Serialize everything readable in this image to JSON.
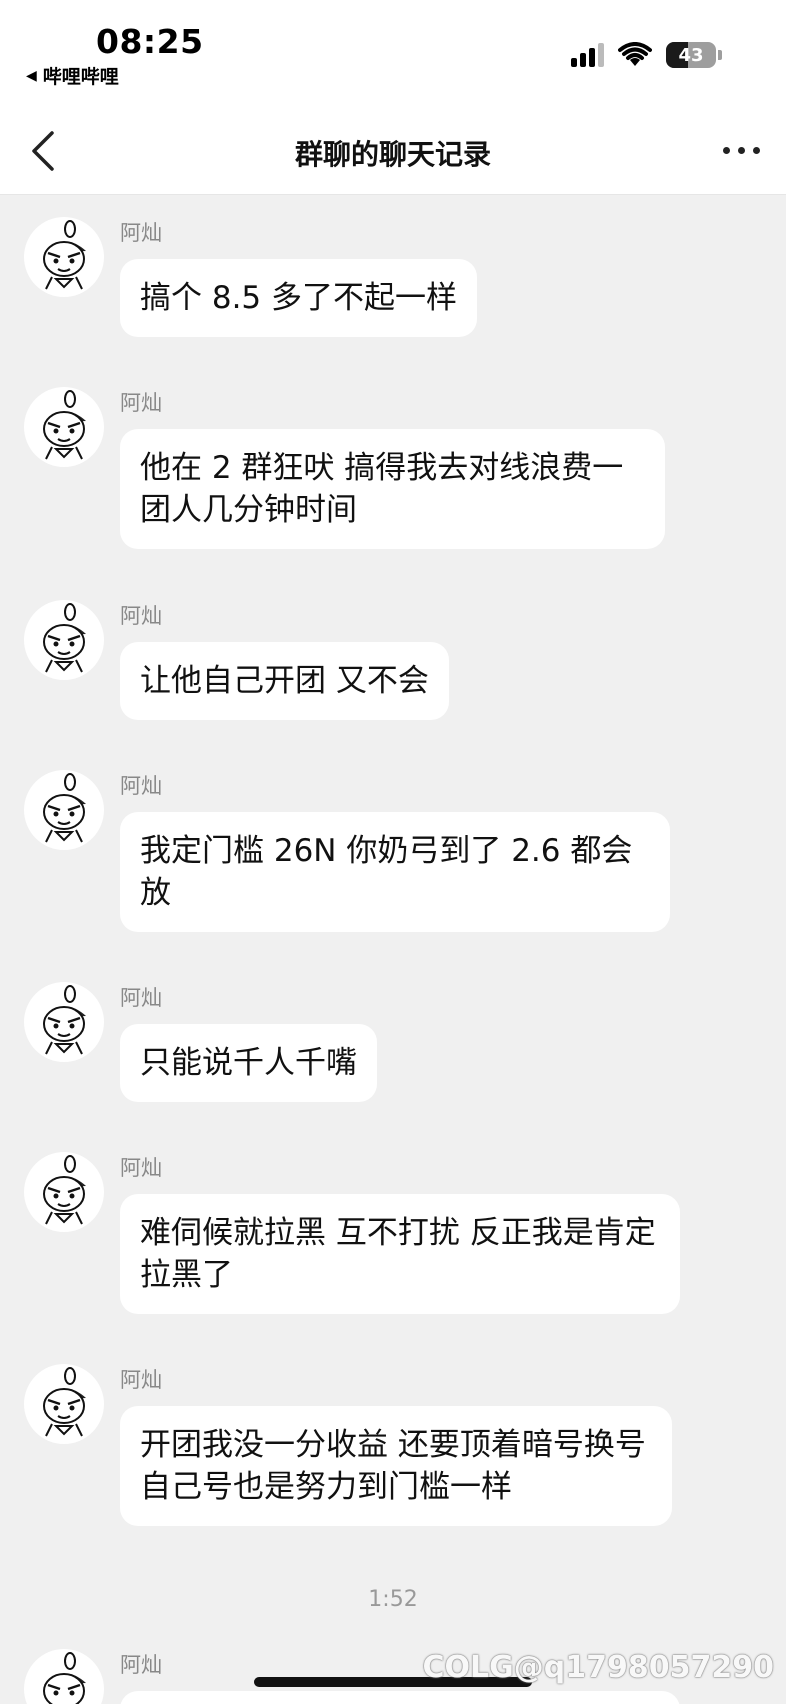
{
  "status_bar": {
    "time": "08:25",
    "back_app": "哔哩哔哩",
    "battery_level": "43",
    "battery_fraction": 0.43
  },
  "nav": {
    "title": "群聊的聊天记录"
  },
  "messages": [
    {
      "sender": "阿灿",
      "text": "搞个 8.5 多了不起一样"
    },
    {
      "sender": "阿灿",
      "text": "他在 2 群狂吠 搞得我去对线浪费一团人几分钟时间"
    },
    {
      "sender": "阿灿",
      "text": "让他自己开团 又不会"
    },
    {
      "sender": "阿灿",
      "text": "我定门槛 26N  你奶弓到了 2.6 都会放"
    },
    {
      "sender": "阿灿",
      "text": "只能说千人千嘴"
    },
    {
      "sender": "阿灿",
      "text": "难伺候就拉黑  互不打扰 反正我是肯定拉黑了"
    },
    {
      "sender": "阿灿",
      "text": "开团我没一分收益 还要顶着暗号换号 自己号也是努力到门槛一样"
    },
    {
      "sender": "阿灿",
      "text": ""
    }
  ],
  "timestamp": "1:52",
  "watermark": "COLG@q1798057290"
}
